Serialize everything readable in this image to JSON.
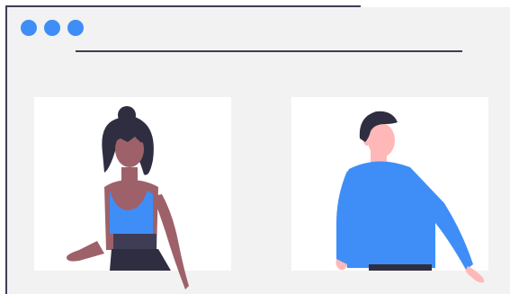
{
  "colors": {
    "window_background": "#f2f2f2",
    "window_border": "#3f3d56",
    "tile_background": "#ffffff",
    "dot_accent": "#3f8ef7",
    "shirt_blue": "#3f8ef7",
    "skin_dark": "#9e616a",
    "skin_light": "#ffb8b8",
    "hair_dark": "#2f2e41",
    "pants_dark": "#2f2e41",
    "belt_dark": "#3f3d56"
  },
  "window": {
    "dots": [
      "window-dot-1",
      "window-dot-2",
      "window-dot-3"
    ]
  },
  "participants": [
    {
      "name": "participant-woman",
      "icon": "woman-illustration"
    },
    {
      "name": "participant-man",
      "icon": "man-illustration"
    }
  ]
}
